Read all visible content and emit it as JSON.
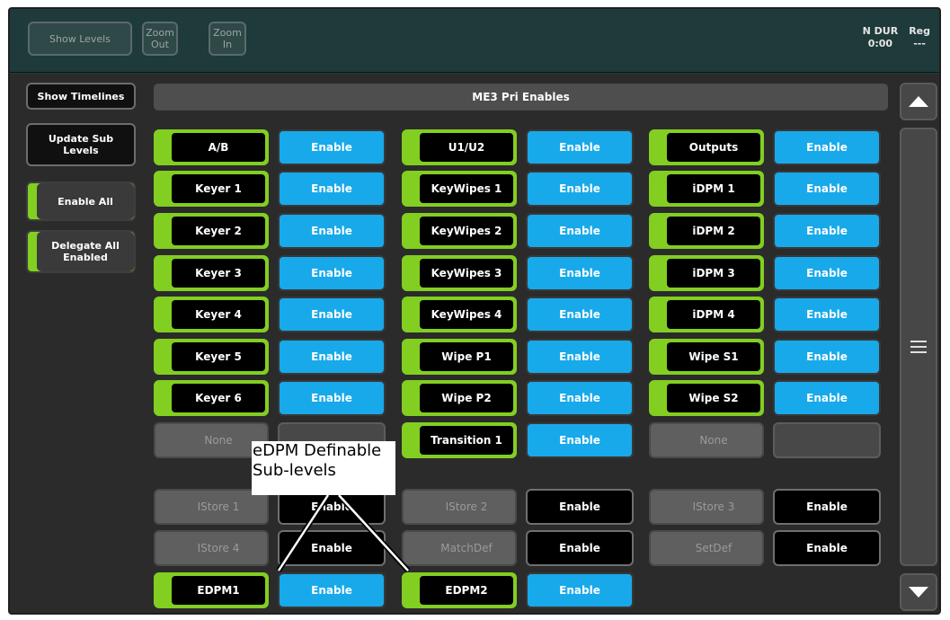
{
  "toolbar": {
    "show_levels": "Show Levels",
    "zoom_out": [
      "Zoom",
      "Out"
    ],
    "zoom_in": [
      "Zoom",
      "In"
    ]
  },
  "status": {
    "ndur_label": "N DUR",
    "ndur_value": "0:00",
    "reg_label": "Reg",
    "reg_value": "---"
  },
  "sidebar": {
    "show_timelines": "Show Timelines",
    "update_sub_levels": [
      "Update Sub",
      "Levels"
    ],
    "enable_all": "Enable All",
    "delegate_all_enabled": [
      "Delegate All",
      "Enabled"
    ]
  },
  "panel_title": "ME3 Pri Enables",
  "grid": {
    "columns": [
      {
        "rows": [
          {
            "label": "A/B",
            "state": "on",
            "enable": "Enable",
            "enable_style": "blue"
          },
          {
            "label": "Keyer 1",
            "state": "on",
            "enable": "Enable",
            "enable_style": "blue"
          },
          {
            "label": "Keyer 2",
            "state": "on",
            "enable": "Enable",
            "enable_style": "blue"
          },
          {
            "label": "Keyer 3",
            "state": "on",
            "enable": "Enable",
            "enable_style": "blue"
          },
          {
            "label": "Keyer 4",
            "state": "on",
            "enable": "Enable",
            "enable_style": "blue"
          },
          {
            "label": "Keyer 5",
            "state": "on",
            "enable": "Enable",
            "enable_style": "blue"
          },
          {
            "label": "Keyer 6",
            "state": "on",
            "enable": "Enable",
            "enable_style": "blue"
          },
          {
            "label": "None",
            "state": "off",
            "enable": "",
            "enable_style": "empty"
          }
        ],
        "sub_rows": [
          {
            "label": "IStore 1",
            "state": "off",
            "enable": "Enable",
            "enable_style": "black"
          },
          {
            "label": "IStore 4",
            "state": "off",
            "enable": "Enable",
            "enable_style": "black"
          },
          {
            "label": "EDPM1",
            "state": "on",
            "enable": "Enable",
            "enable_style": "blue"
          }
        ]
      },
      {
        "rows": [
          {
            "label": "U1/U2",
            "state": "on",
            "enable": "Enable",
            "enable_style": "blue"
          },
          {
            "label": "KeyWipes 1",
            "state": "on",
            "enable": "Enable",
            "enable_style": "blue"
          },
          {
            "label": "KeyWipes 2",
            "state": "on",
            "enable": "Enable",
            "enable_style": "blue"
          },
          {
            "label": "KeyWipes 3",
            "state": "on",
            "enable": "Enable",
            "enable_style": "blue"
          },
          {
            "label": "KeyWipes 4",
            "state": "on",
            "enable": "Enable",
            "enable_style": "blue"
          },
          {
            "label": "Wipe P1",
            "state": "on",
            "enable": "Enable",
            "enable_style": "blue"
          },
          {
            "label": "Wipe P2",
            "state": "on",
            "enable": "Enable",
            "enable_style": "blue"
          },
          {
            "label": "Transition 1",
            "state": "on",
            "enable": "Enable",
            "enable_style": "blue"
          }
        ],
        "sub_rows": [
          {
            "label": "IStore 2",
            "state": "off",
            "enable": "Enable",
            "enable_style": "black"
          },
          {
            "label": "MatchDef",
            "state": "off",
            "enable": "Enable",
            "enable_style": "black"
          },
          {
            "label": "EDPM2",
            "state": "on",
            "enable": "Enable",
            "enable_style": "blue"
          }
        ]
      },
      {
        "rows": [
          {
            "label": "Outputs",
            "state": "on",
            "enable": "Enable",
            "enable_style": "blue"
          },
          {
            "label": "iDPM 1",
            "state": "on",
            "enable": "Enable",
            "enable_style": "blue"
          },
          {
            "label": "iDPM 2",
            "state": "on",
            "enable": "Enable",
            "enable_style": "blue"
          },
          {
            "label": "iDPM 3",
            "state": "on",
            "enable": "Enable",
            "enable_style": "blue"
          },
          {
            "label": "iDPM 4",
            "state": "on",
            "enable": "Enable",
            "enable_style": "blue"
          },
          {
            "label": "Wipe S1",
            "state": "on",
            "enable": "Enable",
            "enable_style": "blue"
          },
          {
            "label": "Wipe S2",
            "state": "on",
            "enable": "Enable",
            "enable_style": "blue"
          },
          {
            "label": "None",
            "state": "off",
            "enable": "",
            "enable_style": "empty"
          }
        ],
        "sub_rows": [
          {
            "label": "IStore 3",
            "state": "off",
            "enable": "Enable",
            "enable_style": "black"
          },
          {
            "label": "SetDef",
            "state": "off",
            "enable": "Enable",
            "enable_style": "black"
          }
        ]
      }
    ]
  },
  "scrollbar": {
    "up_icon": "triangle-up-icon",
    "thumb_icon": "hamburger-icon",
    "down_icon": "triangle-down-icon"
  },
  "callout": [
    "eDPM Definable",
    "Sub-levels"
  ],
  "colors": {
    "accent_green": "#82ce21",
    "enable_blue": "#18a9ea"
  }
}
